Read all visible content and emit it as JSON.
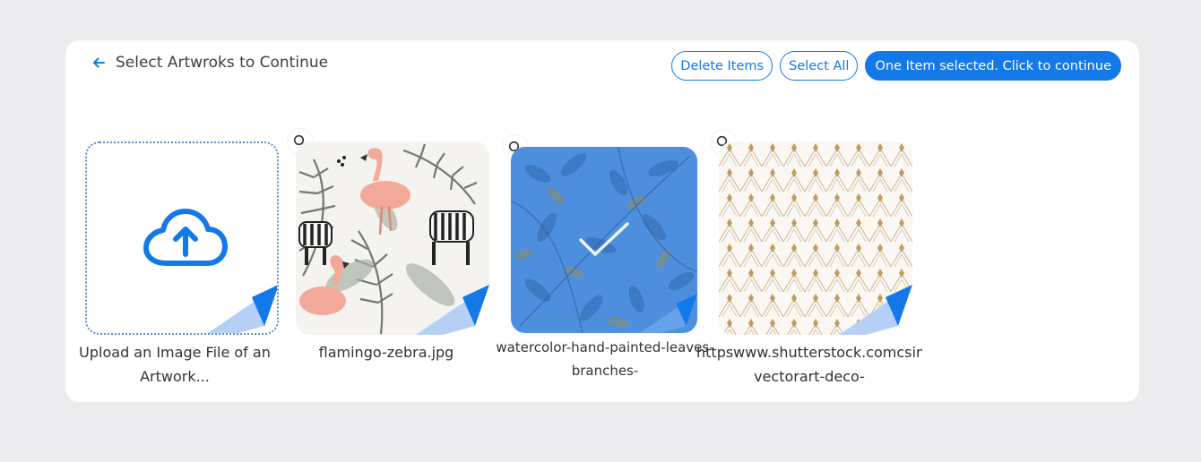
{
  "header": {
    "title": "Select Artwroks to Continue"
  },
  "actions": {
    "delete_label": "Delete Items",
    "select_all_label": "Select All",
    "continue_label": "One Item selected. Click to continue"
  },
  "upload": {
    "label": "Upload an Image File of an Artwork..."
  },
  "artworks": [
    {
      "name": "flamingo-zebra.jpg",
      "selected": false
    },
    {
      "name": "watercolor-hand-painted-leaves-branches-",
      "selected": true
    },
    {
      "name": "httpswww.shutterstock.comcsimage-vectorart-deco-",
      "selected": false
    }
  ],
  "colors": {
    "accent": "#1479e8",
    "background": "#ececee",
    "panel": "#ffffff"
  }
}
